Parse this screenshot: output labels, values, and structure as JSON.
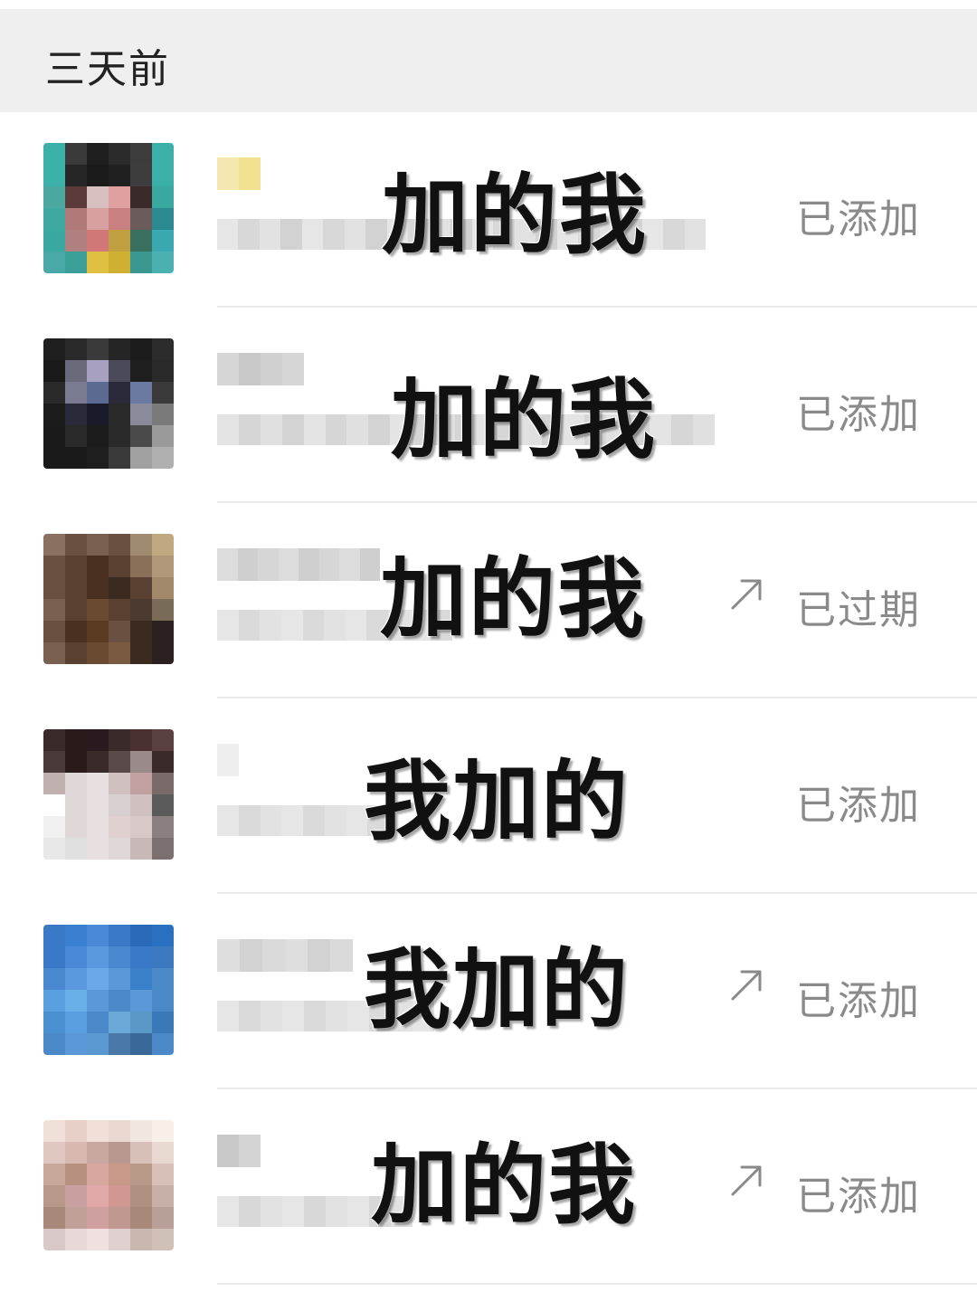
{
  "section": {
    "title": "三天前"
  },
  "rows": [
    {
      "overlay": "加的我",
      "status": "已添加",
      "has_arrow": false,
      "avatar_colors": [
        "#3bb0a8",
        "#3a3a3a",
        "#1f1f1f",
        "#2b2b2b",
        "#3c3c3c",
        "#3bb0a8",
        "#3bb0a8",
        "#262626",
        "#1b1b1b",
        "#202020",
        "#3d3d3d",
        "#3bb0a8",
        "#4aa8a0",
        "#5b3a3a",
        "#d8c0c0",
        "#e0a0a0",
        "#3a2a2a",
        "#3aa8a0",
        "#3fa8a0",
        "#b07a7a",
        "#d8a0a0",
        "#c88080",
        "#6a5a5a",
        "#2a8a90",
        "#3aa8a0",
        "#b08080",
        "#d07878",
        "#c0a040",
        "#3a7060",
        "#3aa8b0",
        "#4aa8a8",
        "#3aa098",
        "#e0c040",
        "#d0b030",
        "#3a9890",
        "#4ab0b0"
      ]
    },
    {
      "overlay": "加的我",
      "status": "已添加",
      "has_arrow": false,
      "avatar_colors": [
        "#1e1e1e",
        "#2a2a2a",
        "#3a3a3a",
        "#252525",
        "#1c1c1c",
        "#2c2c2c",
        "#1a1a1a",
        "#6a6a7a",
        "#a8a0c0",
        "#4a4a5a",
        "#1e1e1e",
        "#2a2a2a",
        "#2a2a2a",
        "#7a7a90",
        "#5a6a90",
        "#2a2a3a",
        "#6a7aa0",
        "#3a3a3a",
        "#1c1c1c",
        "#2a2a3a",
        "#1a1a2a",
        "#2a2a2a",
        "#8a8a9a",
        "#7a7a7a",
        "#1a1a1a",
        "#2a2a2a",
        "#1c1c1c",
        "#2a2a2a",
        "#4a4a4a",
        "#9a9a9a",
        "#1a1a1a",
        "#1a1a1a",
        "#1e1e1e",
        "#3a3a3a",
        "#a0a0a0",
        "#b0b0b0"
      ]
    },
    {
      "overlay": "加的我",
      "status": "已过期",
      "has_arrow": true,
      "avatar_colors": [
        "#8a7060",
        "#6a5040",
        "#7a6050",
        "#6a5040",
        "#a08a70",
        "#c0a880",
        "#6a5040",
        "#5a4030",
        "#4a3020",
        "#5a4030",
        "#8a7058",
        "#b09878",
        "#6a5040",
        "#5a4030",
        "#4a3020",
        "#3a2a20",
        "#5a4030",
        "#a08868",
        "#7a6050",
        "#5a4030",
        "#6a4a30",
        "#5a4030",
        "#4a3a30",
        "#7a6a58",
        "#6a5040",
        "#4a3020",
        "#5a3a20",
        "#6a5040",
        "#3a2a20",
        "#2a2020",
        "#7a6050",
        "#5a4030",
        "#6a4a30",
        "#7a5a40",
        "#3a2a20",
        "#2a2020"
      ]
    },
    {
      "overlay": "我加的",
      "status": "已添加",
      "has_arrow": false,
      "avatar_colors": [
        "#3a2a2a",
        "#2a1a1a",
        "#2a1a20",
        "#3a2a2a",
        "#4a3030",
        "#5a4040",
        "#4a3a3a",
        "#2a1a1a",
        "#3a2a2a",
        "#5a4a4a",
        "#9a8a8a",
        "#3a2a2a",
        "#c0b0b0",
        "#e0d8d8",
        "#e8e0e0",
        "#d0c0c0",
        "#c0a0a0",
        "#7a6a6a",
        "#ffffff",
        "#e0d8d8",
        "#e8e0e0",
        "#d8d0d0",
        "#d0c0c0",
        "#5a5a5a",
        "#f0f0f0",
        "#e0d8d8",
        "#e8e0e0",
        "#e0d0d0",
        "#d8c8c8",
        "#8a8080",
        "#e8e8e8",
        "#e0e0e0",
        "#e8e0e0",
        "#e0d8d8",
        "#c8b8b8",
        "#7a7070"
      ]
    },
    {
      "overlay": "我加的",
      "status": "已添加",
      "has_arrow": true,
      "avatar_colors": [
        "#3a78c8",
        "#3a80d0",
        "#4a88d8",
        "#3a78c8",
        "#2a68b8",
        "#2a70c0",
        "#3a78c8",
        "#4a88d8",
        "#5a98e0",
        "#4a88d0",
        "#3a78c8",
        "#3a78c0",
        "#4a88d0",
        "#5a98e0",
        "#6aa8e8",
        "#5a98d8",
        "#3a80c8",
        "#4a88c8",
        "#5aa0e0",
        "#6ab0e8",
        "#5a98d8",
        "#4a88c8",
        "#5a98d8",
        "#4a88c8",
        "#4a90d0",
        "#5aa0e0",
        "#4a88c8",
        "#6aa8d8",
        "#5a98c8",
        "#3a78b8",
        "#4a88c8",
        "#5a98d8",
        "#5a98d0",
        "#4a78a8",
        "#3a6898",
        "#4a88c8"
      ]
    },
    {
      "overlay": "加的我",
      "status": "已添加",
      "has_arrow": true,
      "avatar_colors": [
        "#f0e0d8",
        "#e8d0c8",
        "#f0e0d8",
        "#e8d8d0",
        "#f0e8e0",
        "#f8f0e8",
        "#e0c8c0",
        "#d8b8b0",
        "#c8a8a0",
        "#b89890",
        "#d8c0b8",
        "#e8d8d0",
        "#c8a898",
        "#b89080",
        "#d8a8a0",
        "#c89888",
        "#b89888",
        "#d8c0b8",
        "#b89888",
        "#c8a0a0",
        "#e0a8a8",
        "#d09890",
        "#b09080",
        "#c8b0a8",
        "#a88878",
        "#c0a098",
        "#d0a0a0",
        "#c09890",
        "#a88878",
        "#b8a098",
        "#d8c8c8",
        "#e8d8d8",
        "#f0e0e0",
        "#e0d0d0",
        "#c8b8b0",
        "#d0c0b8"
      ]
    }
  ]
}
